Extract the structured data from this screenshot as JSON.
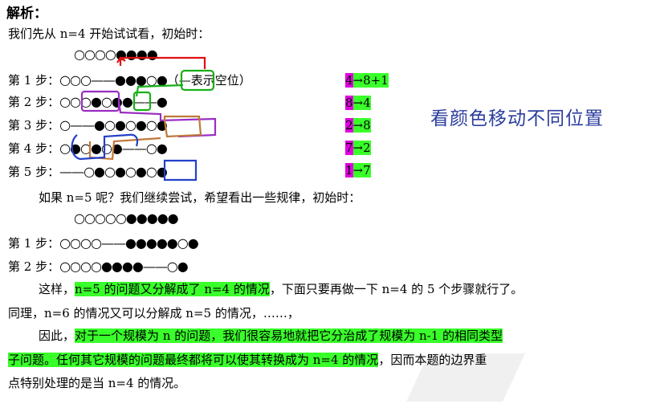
{
  "title": "解析：",
  "intro": "我们先从 n=4 开始试试看，初始时：",
  "n4_initial": "○○○○●●●●",
  "steps4": [
    {
      "label": "第 1 步：",
      "balls": "○○○——●●●○●",
      "note": "（—表示空位）",
      "move": [
        "4",
        "→8+1"
      ]
    },
    {
      "label": "第 2 步：",
      "balls": "○○○●○●●——●",
      "note": "",
      "move": [
        "8",
        "→4"
      ]
    },
    {
      "label": "第 3 步：",
      "balls": "○——●○●○●○●",
      "note": "",
      "move": [
        "2",
        "→8"
      ]
    },
    {
      "label": "第 4 步：",
      "balls": "○●○●○●——○●",
      "note": "",
      "move": [
        "7",
        "→2"
      ]
    },
    {
      "label": "第 5 步：",
      "balls": "——○●○●○●○●",
      "note": "",
      "move": [
        "1",
        "→7"
      ]
    }
  ],
  "annotation": "看颜色移动不同位置",
  "n5_question": "如果 n=5 呢？我们继续尝试，希望看出一些规律，初始时：",
  "n5_initial": "○○○○○●●●●●",
  "steps5": [
    {
      "label": "第 1 步：",
      "balls": "○○○○——●●●●●○●"
    },
    {
      "label": "第 2 步：",
      "balls": "○○○○●●●●——○●"
    }
  ],
  "para1": {
    "pre": "这样，",
    "hl": "n=5 的问题又分解成了 n=4 的情况",
    "post": "，下面只要再做一下 n=4 的 5 个步骤就行了。"
  },
  "para2": "同理，n=6 的情况又可以分解成 n=5 的情况，……，",
  "para3": {
    "pre": "因此，",
    "hl1": "对于一个规模为 n 的问题，我们很容易地就把它分治成了规模为 n-1 的相同类型",
    "hl2": "子问题。任何其它规模的问题最终都将可以使其转换成为  n=4  的情况",
    "post": "，因而本题的边界重",
    "last": "点特别处理的是当 n=4 的情况。"
  },
  "colors": {
    "highlight": "#39ff2a",
    "magenta": "#e000e0",
    "note_blue": "#2c3e9e"
  }
}
